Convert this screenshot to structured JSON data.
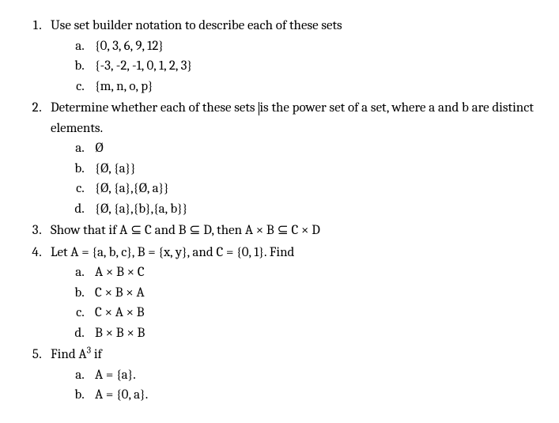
{
  "q1": {
    "text": "Use set builder notation to describe each of these sets",
    "a": "{0, 3, 6, 9, 12}",
    "b": "{-3, -2, -1, 0, 1, 2, 3}",
    "c": "{m, n, o, p}"
  },
  "q2": {
    "text_before": "Determine whether each of these sets ",
    "text_after": "is the power set of a set, where a and b are distinct elements.",
    "a": "Ø",
    "b": "{Ø, {a}}",
    "c": "{Ø, {a},{Ø, a}}",
    "d": "{Ø, {a},{b},{a, b}}"
  },
  "q3": {
    "text": "Show that if A ⊆ C and B ⊆ D, then A × B ⊆ C × D"
  },
  "q4": {
    "text": "Let A = {a, b, c}, B = {x, y}, and C = {0, 1}. Find",
    "a": "A × B × C",
    "b": "C × B × A",
    "c": "C × A × B",
    "d": "B × B × B"
  },
  "q5": {
    "text_before": "Find A",
    "sup": "3",
    "text_after": " if",
    "a": "A = {a}.",
    "b": "A = {0, a}."
  }
}
